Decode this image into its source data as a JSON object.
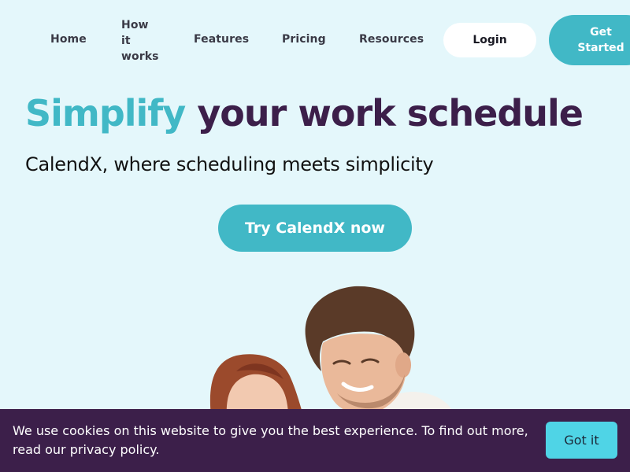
{
  "nav": {
    "items": [
      {
        "label": "Home"
      },
      {
        "label": "How it works"
      },
      {
        "label": "Features"
      },
      {
        "label": "Pricing"
      },
      {
        "label": "Resources"
      }
    ],
    "login_label": "Login",
    "get_started_label": "Get Started"
  },
  "hero": {
    "title_accent": "Simplify",
    "title_rest": "your work schedule",
    "subtitle": "CalendX, where scheduling meets simplicity",
    "cta_label": "Try CalendX now"
  },
  "cookie": {
    "message": "We use cookies on this website to give you the best experience. To find out more, read our privacy policy.",
    "accept_label": "Got it"
  },
  "colors": {
    "background": "#e4f7fb",
    "accent": "#41b8c6",
    "brand_dark": "#3c1f4a",
    "cookie_button": "#4fd4e6"
  }
}
